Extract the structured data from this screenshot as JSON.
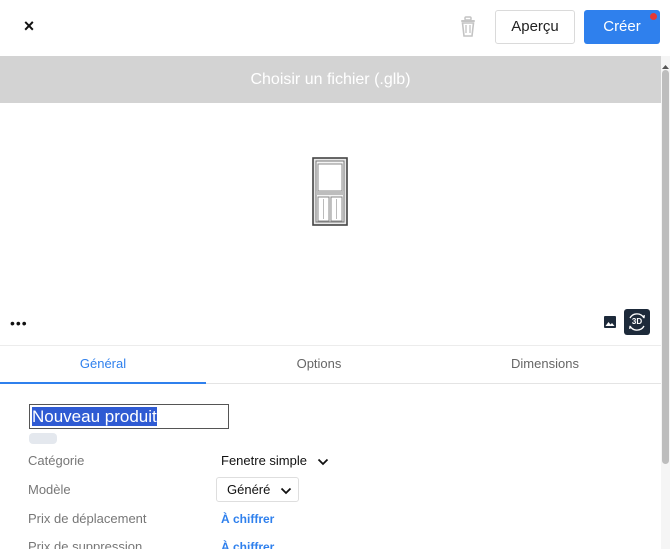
{
  "header": {
    "close_label": "×",
    "preview_label": "Aperçu",
    "create_label": "Créer"
  },
  "upload": {
    "label": "Choisir un fichier (.glb)"
  },
  "viewer": {
    "more_label": "•••",
    "mode_3d_label": "3D"
  },
  "tabs": [
    {
      "label": "Général",
      "active": true
    },
    {
      "label": "Options",
      "active": false
    },
    {
      "label": "Dimensions",
      "active": false
    }
  ],
  "form": {
    "product_name": "Nouveau produit",
    "rows": [
      {
        "label": "Catégorie",
        "value": "Fenetre simple"
      },
      {
        "label": "Modèle",
        "value": "Généré"
      },
      {
        "label": "Prix de déplacement",
        "value": "À chiffrer"
      },
      {
        "label": "Prix de suppression",
        "value": "À chiffrer"
      }
    ]
  },
  "colors": {
    "accent": "#2f80ed",
    "notification_dot": "#e53935",
    "upload_bar": "#d3d3d3",
    "toggle_3d_bg": "#1d2a3a"
  }
}
